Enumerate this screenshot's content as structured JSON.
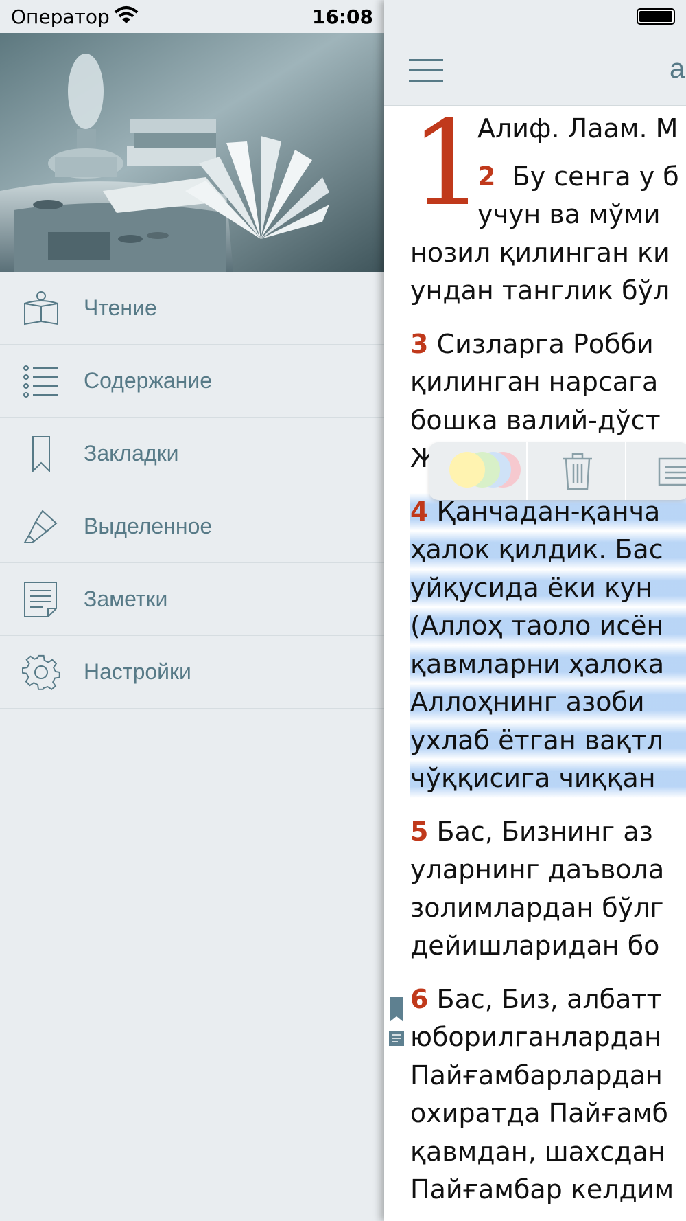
{
  "status_bar": {
    "carrier": "Оператор",
    "time": "16:08",
    "wifi_icon": "wifi-icon",
    "battery_icon": "battery-icon"
  },
  "drawer": {
    "hero_image": "still-life-books-lamp-image",
    "menu": [
      {
        "label": "Чтение",
        "icon": "open-book-icon"
      },
      {
        "label": "Содержание",
        "icon": "list-icon"
      },
      {
        "label": "Закладки",
        "icon": "bookmark-icon"
      },
      {
        "label": "Выделенное",
        "icon": "highlighter-icon"
      },
      {
        "label": "Заметки",
        "icon": "note-icon"
      },
      {
        "label": "Настройки",
        "icon": "gear-icon"
      }
    ]
  },
  "reader": {
    "title": "a",
    "chapter_number": "1",
    "verses": [
      {
        "num": "",
        "lines": [
          "Алиф. Лаам. М"
        ]
      },
      {
        "num": "2",
        "lines": [
          "Бу сенга у б",
          "учун ва мўми",
          "нозил қилинган ки",
          "ундан танглик бўл"
        ]
      },
      {
        "num": "3",
        "lines": [
          "Сизларга Робби",
          "қилинган нарсага",
          "бошка валий-дўст",
          "Ж"
        ]
      },
      {
        "num": "4",
        "lines": [
          "Қанчадан-қанча",
          "ҳалок қилдик. Бас",
          "уйқусида ёки кун",
          "(Аллоҳ таоло исён",
          "қавмларни ҳалока",
          "Аллоҳнинг азоби",
          "ухлаб ётган вақтл",
          "чўққисига чиққан"
        ]
      },
      {
        "num": "5",
        "lines": [
          "Бас, Бизнинг аз",
          "уларнинг даъвола",
          "золимлардан бўлг",
          "дейишларидан бо"
        ]
      },
      {
        "num": "6",
        "lines": [
          "Бас, Биз, албатт",
          "юборилганлардан",
          "Пайғамбарлардан",
          "охиратда Пайғамб",
          "қавмдан, шахсдан",
          "Пайғамбар келдим"
        ]
      }
    ],
    "highlight_colors": [
      "#fff3b0",
      "#d8f0c8",
      "#cfe2f7",
      "#f6c9cf"
    ]
  }
}
